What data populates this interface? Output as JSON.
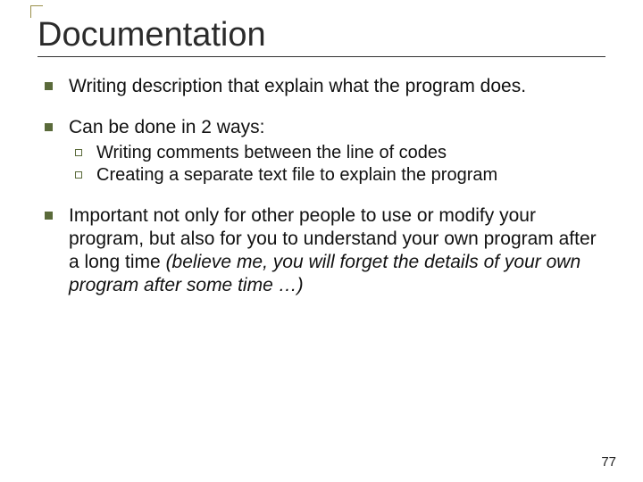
{
  "title": "Documentation",
  "bullets": [
    {
      "text": "Writing description that explain what the program does."
    },
    {
      "text": "Can be done in 2 ways:",
      "sub": [
        "Writing comments between the line of codes",
        "Creating a separate text file to explain the program"
      ]
    },
    {
      "text": "Important not only for other people to use or modify your program, but also for you to understand your own program after a long time ",
      "italic_tail": "(believe me, you will forget the details of your own program after some time …)"
    }
  ],
  "page_number": "77"
}
